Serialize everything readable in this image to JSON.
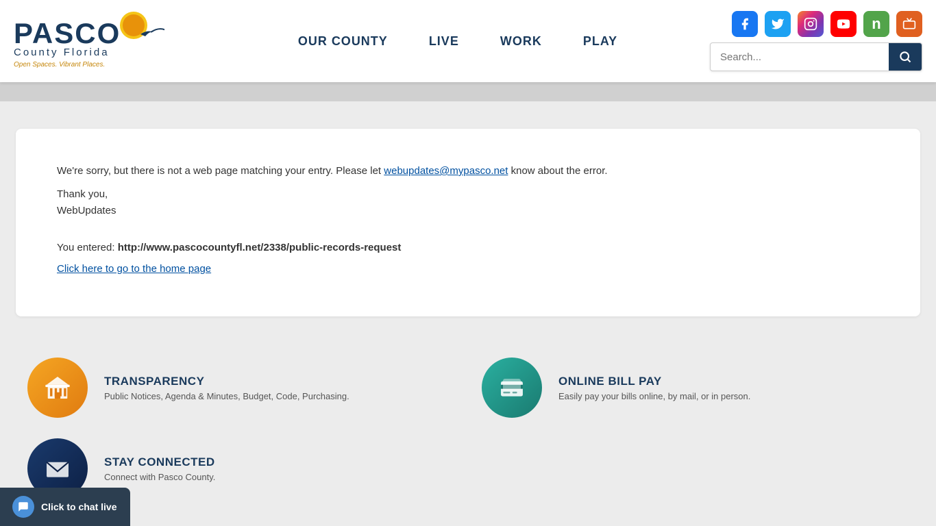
{
  "header": {
    "logo": {
      "line1": "PASCO",
      "line2": "County Florida",
      "tagline": "Open Spaces. Vibrant Places."
    },
    "nav": {
      "items": [
        {
          "label": "OUR COUNTY",
          "id": "our-county"
        },
        {
          "label": "LIVE",
          "id": "live"
        },
        {
          "label": "WORK",
          "id": "work"
        },
        {
          "label": "PLAY",
          "id": "play"
        }
      ]
    },
    "social": {
      "facebook_title": "Facebook",
      "twitter_title": "Twitter",
      "instagram_title": "Instagram",
      "youtube_title": "YouTube",
      "nextdoor_title": "Nextdoor",
      "tv_title": "PascoTV"
    },
    "search": {
      "placeholder": "Search...",
      "button_label": "🔍"
    }
  },
  "error_page": {
    "message_before_link": "We're sorry, but there is not a web page matching your entry. Please let ",
    "email_link_text": "webupdates@mypasco.net",
    "email_href": "mailto:webupdates@mypasco.net",
    "message_after_link": " know about the error.",
    "thank_you": "Thank you,",
    "web_updates": "WebUpdates",
    "you_entered_label": "You entered:",
    "entered_url": "http://www.pascocountyfl.net/2338/public-records-request",
    "home_link_text": "Click here to go to the home page"
  },
  "widgets": [
    {
      "id": "transparency",
      "title": "TRANSPARENCY",
      "description": "Public Notices, Agenda & Minutes, Budget, Code, Purchasing.",
      "icon_color": "orange"
    },
    {
      "id": "online-bill-pay",
      "title": "ONLINE BILL PAY",
      "description": "Easily pay your bills online, by mail, or in person.",
      "icon_color": "teal"
    },
    {
      "id": "stay-connected",
      "title": "STAY CONNECTED",
      "description": "Connect with Pasco County.",
      "icon_color": "navy"
    }
  ],
  "chat": {
    "label": "Click to chat live"
  }
}
